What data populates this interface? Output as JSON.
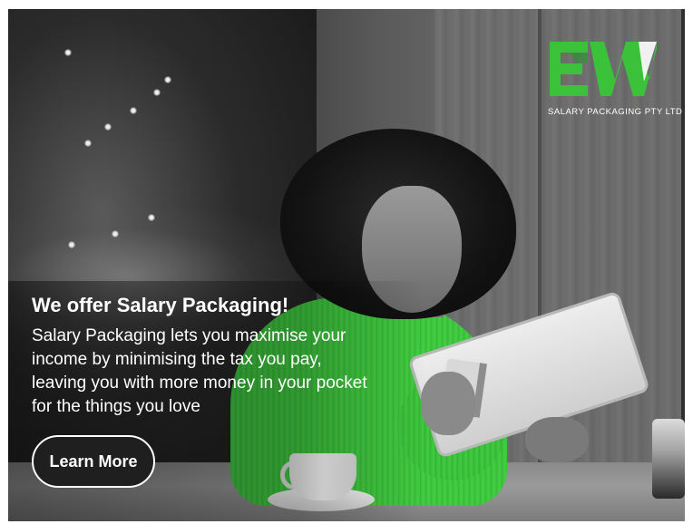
{
  "brand": {
    "logo_letters": "EW",
    "tagline": "SALARY PACKAGING PTY LTD",
    "accent_color": "#3cc13b"
  },
  "hero": {
    "headline": "We offer Salary Packaging!",
    "body_lines": [
      "Salary Packaging lets you maximise your",
      "income by minimising the tax you pay,",
      "leaving you with more money in your pocket",
      "for the things you love"
    ],
    "cta_label": "Learn More"
  }
}
